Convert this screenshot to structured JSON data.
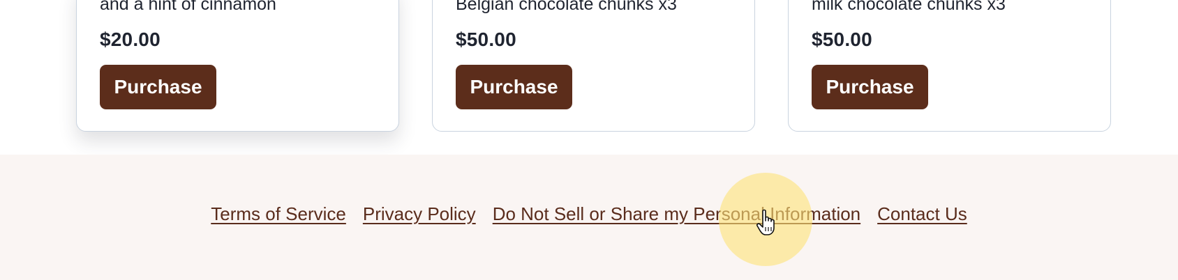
{
  "products": [
    {
      "description": "and a hint of cinnamon",
      "price": "$20.00",
      "button_label": "Purchase"
    },
    {
      "description": "Belgian chocolate chunks x3",
      "price": "$50.00",
      "button_label": "Purchase"
    },
    {
      "description": "milk chocolate chunks x3",
      "price": "$50.00",
      "button_label": "Purchase"
    }
  ],
  "footer": {
    "links": [
      {
        "label": "Terms of Service"
      },
      {
        "label": "Privacy Policy"
      },
      {
        "label": "Do Not Sell or Share my Personal Information"
      },
      {
        "label": "Contact Us"
      }
    ]
  },
  "colors": {
    "button_bg": "#5c2d1b",
    "link": "#5a2c1c",
    "footer_bg": "#faf5f3",
    "click_highlight": "#fde278"
  },
  "icons": {
    "cursor": "hand-pointer-icon"
  }
}
